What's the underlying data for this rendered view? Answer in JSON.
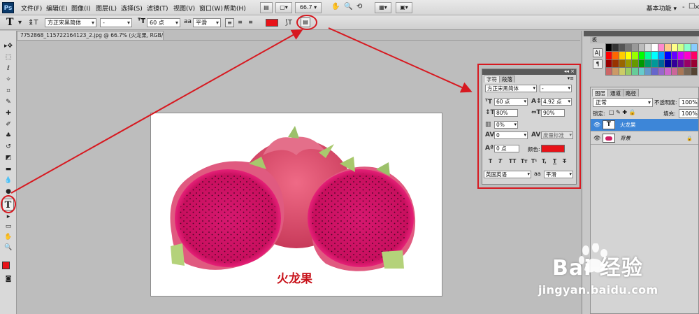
{
  "app": {
    "logo": "Ps"
  },
  "menu": {
    "items": [
      "文件(F)",
      "编辑(E)",
      "图像(I)",
      "图层(L)",
      "选择(S)",
      "滤镜(T)",
      "视图(V)",
      "窗口(W)",
      "帮助(H)"
    ],
    "zoom": "66.7",
    "workspace": "基本功能",
    "window_controls": [
      "-",
      "□",
      "×"
    ]
  },
  "options": {
    "tool_icon": "T",
    "font_family": "方正宋黑简体",
    "font_style": "-",
    "font_size": "60 点",
    "antialias_prefix": "a",
    "antialias": "平滑",
    "text_color": "#e81218"
  },
  "document": {
    "tab_title": "7752868_115722164123_2.jpg @ 66.7% (火龙果, RGB/8) *",
    "canvas_text": "火龙果",
    "canvas_text_color": "#c8121a"
  },
  "toolbox": {
    "text_tool_icon": "T"
  },
  "character_panel": {
    "tabs": [
      "字符",
      "段落"
    ],
    "font_family": "方正宋黑简体",
    "font_style": "-",
    "font_size": "60 点",
    "leading": "4.92 点",
    "vertical_scale": "80%",
    "horizontal_scale": "90%",
    "tracking": "0%",
    "kerning": "0",
    "kerning_mode": "度量标准",
    "baseline_shift": "0 点",
    "color_label": "颜色:",
    "color": "#e81218",
    "format_buttons": [
      "T",
      "T",
      "TT",
      "Tт",
      "T¹",
      "T,",
      "T",
      "T"
    ],
    "language": "英国英语",
    "antialias_prefix": "a",
    "antialias": "平滑"
  },
  "swatches": {
    "tab_label": "板"
  },
  "layers": {
    "tabs": [
      "图层",
      "通道",
      "路径"
    ],
    "blend_mode": "正常",
    "opacity_label": "不透明度:",
    "opacity": "100%",
    "lock_label": "锁定:",
    "fill_label": "填充:",
    "fill": "100%",
    "rows": [
      {
        "name": "火龙果",
        "thumb": "T",
        "selected": true
      },
      {
        "name": "背景",
        "thumb": "",
        "selected": false
      }
    ]
  },
  "watermark": {
    "brand": "Bai  经验",
    "url": "jingyan.baidu.com"
  }
}
